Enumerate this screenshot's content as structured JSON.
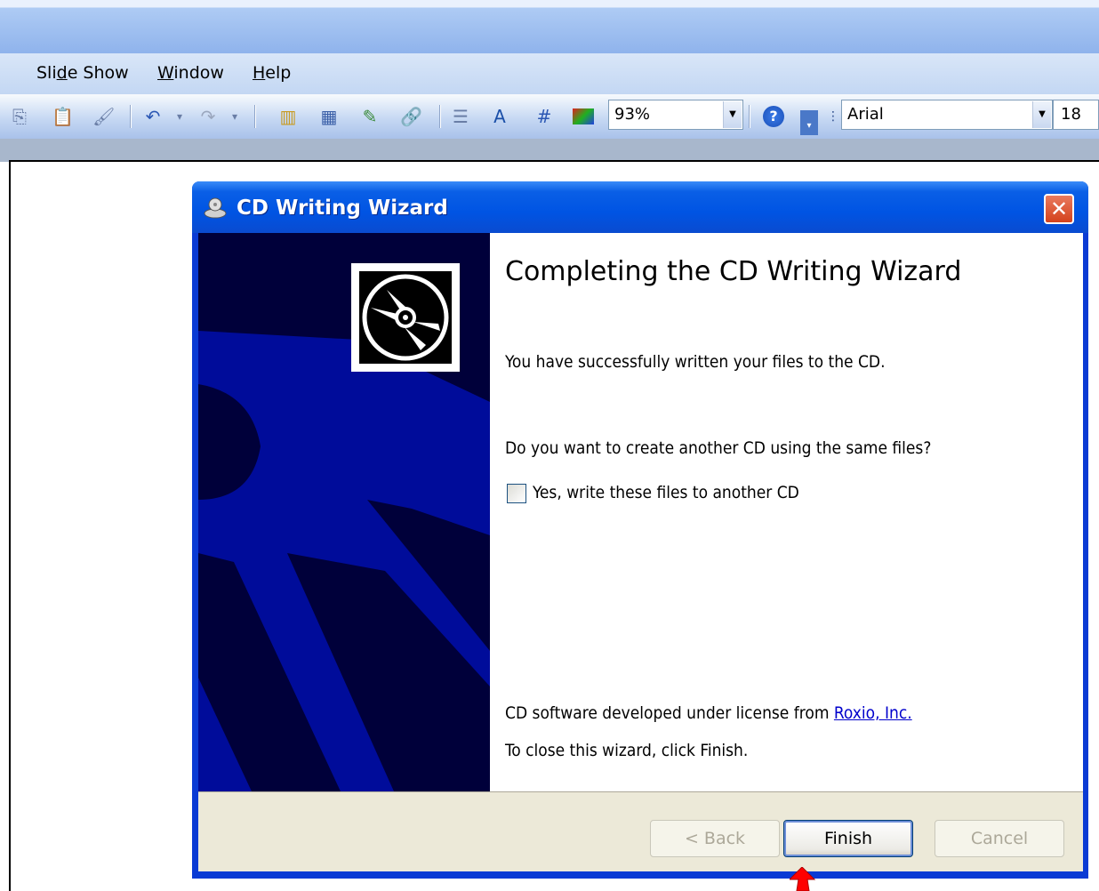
{
  "app": {
    "menu": [
      {
        "label": "Slide Show",
        "underline_index": 3
      },
      {
        "label": "Window",
        "underline_index": 0
      },
      {
        "label": "Help",
        "underline_index": 0
      }
    ],
    "toolbar": {
      "zoom_value": "93%",
      "font_name": "Arial",
      "font_size": "18"
    }
  },
  "dialog": {
    "title": "CD Writing Wizard",
    "close_symbol": "✕",
    "heading": "Completing the CD Writing Wizard",
    "success_text": "You have successfully written your files to the CD.",
    "question_text": "Do you want to create another CD using the same files?",
    "checkbox_label": "Yes, write these files to another CD",
    "checkbox_checked": false,
    "license_prefix": "CD software developed under license from ",
    "license_link": "Roxio, Inc.",
    "close_hint": "To close this wizard, click Finish.",
    "buttons": {
      "back": "< Back",
      "finish": "Finish",
      "cancel": "Cancel"
    }
  },
  "colors": {
    "title_bar": "#0054e3",
    "wizard_panel_bg": "#00003a",
    "wizard_panel_graphic": "#000c9a",
    "link": "#0000cc",
    "pointer": "#ff0000"
  },
  "icons": [
    "cd-icon",
    "cd-writer-title-icon",
    "close-icon",
    "arrow-pointer-icon"
  ]
}
